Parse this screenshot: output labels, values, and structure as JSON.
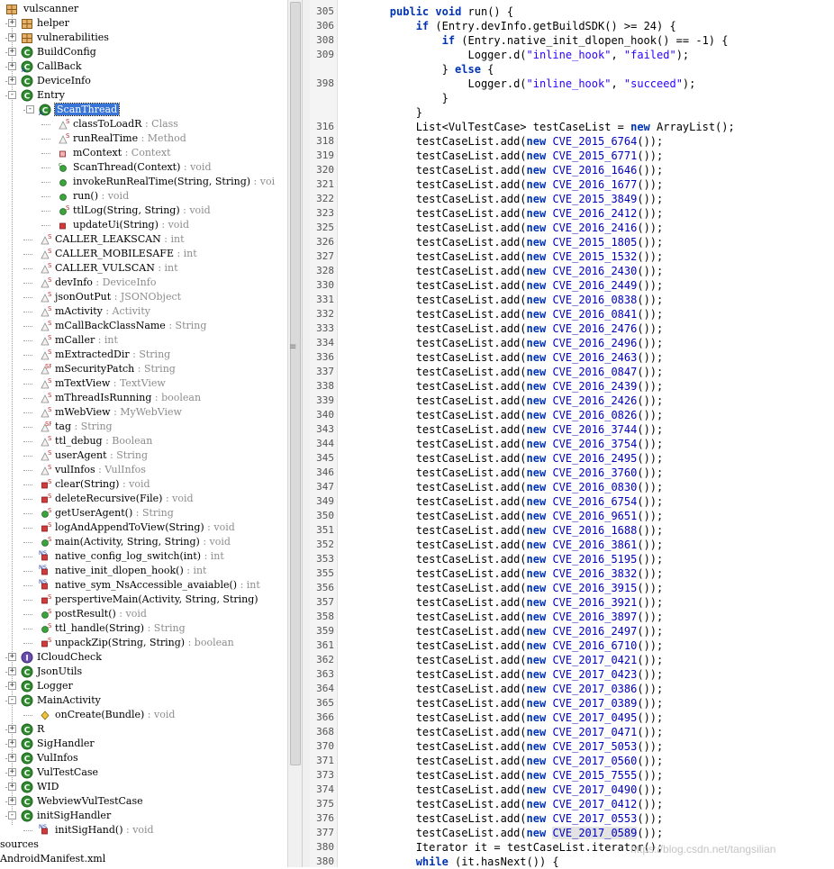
{
  "tree": {
    "root": "vulscanner",
    "items": [
      {
        "label": "helper",
        "icon": "package-icon",
        "depth": 1,
        "toggle": "+"
      },
      {
        "label": "vulnerabilities",
        "icon": "package-icon",
        "depth": 1,
        "toggle": "+"
      },
      {
        "label": "BuildConfig",
        "icon": "class-icon",
        "depth": 1,
        "toggle": "+"
      },
      {
        "label": "CallBack",
        "icon": "abstract-class-icon",
        "depth": 1,
        "toggle": "+"
      },
      {
        "label": "DeviceInfo",
        "icon": "class-icon",
        "depth": 1,
        "toggle": "+"
      },
      {
        "label": "Entry",
        "icon": "class-icon",
        "depth": 1,
        "toggle": "-"
      },
      {
        "label": "ScanThread",
        "icon": "inner-class-icon",
        "depth": 2,
        "toggle": "-",
        "selected": true
      },
      {
        "label": "classToLoadR",
        "type": "Class",
        "icon": "static-field-icon",
        "depth": 3
      },
      {
        "label": "runRealTime",
        "type": "Method",
        "icon": "static-field-icon",
        "depth": 3
      },
      {
        "label": "mContext",
        "type": "Context",
        "icon": "private-field-icon",
        "depth": 3
      },
      {
        "label": "ScanThread(Context)",
        "type": "void",
        "icon": "constructor-icon",
        "depth": 3
      },
      {
        "label": "invokeRunRealTime(String, String)",
        "type": "voi",
        "icon": "public-method-icon",
        "depth": 3
      },
      {
        "label": "run()",
        "type": "void",
        "icon": "public-method-icon",
        "depth": 3
      },
      {
        "label": "ttlLog(String, String)",
        "type": "void",
        "icon": "static-method-icon",
        "depth": 3
      },
      {
        "label": "updateUi(String)",
        "type": "void",
        "icon": "private-method-icon",
        "depth": 3
      },
      {
        "label": "CALLER_LEAKSCAN",
        "type": "int",
        "icon": "static-field-icon",
        "depth": 2
      },
      {
        "label": "CALLER_MOBILESAFE",
        "type": "int",
        "icon": "static-field-icon",
        "depth": 2
      },
      {
        "label": "CALLER_VULSCAN",
        "type": "int",
        "icon": "static-field-icon",
        "depth": 2
      },
      {
        "label": "devInfo",
        "type": "DeviceInfo",
        "icon": "static-field-icon",
        "depth": 2
      },
      {
        "label": "jsonOutPut",
        "type": "JSONObject",
        "icon": "static-field-icon",
        "depth": 2
      },
      {
        "label": "mActivity",
        "type": "Activity",
        "icon": "static-field-icon",
        "depth": 2
      },
      {
        "label": "mCallBackClassName",
        "type": "String",
        "icon": "static-field-icon",
        "depth": 2
      },
      {
        "label": "mCaller",
        "type": "int",
        "icon": "static-field-icon",
        "depth": 2
      },
      {
        "label": "mExtractedDir",
        "type": "String",
        "icon": "static-field-icon",
        "depth": 2
      },
      {
        "label": "mSecurityPatch",
        "type": "String",
        "icon": "static-final-field-icon",
        "depth": 2
      },
      {
        "label": "mTextView",
        "type": "TextView",
        "icon": "static-field-icon",
        "depth": 2
      },
      {
        "label": "mThreadIsRunning",
        "type": "boolean",
        "icon": "static-field-icon",
        "depth": 2
      },
      {
        "label": "mWebView",
        "type": "MyWebView",
        "icon": "static-field-icon",
        "depth": 2
      },
      {
        "label": "tag",
        "type": "String",
        "icon": "static-final-field-icon",
        "depth": 2
      },
      {
        "label": "ttl_debug",
        "type": "Boolean",
        "icon": "static-field-icon",
        "depth": 2
      },
      {
        "label": "userAgent",
        "type": "String",
        "icon": "static-field-icon",
        "depth": 2
      },
      {
        "label": "vulInfos",
        "type": "VulInfos",
        "icon": "static-field-icon",
        "depth": 2
      },
      {
        "label": "clear(String)",
        "type": "void",
        "icon": "private-static-method-icon",
        "depth": 2
      },
      {
        "label": "deleteRecursive(File)",
        "type": "void",
        "icon": "private-static-method-icon",
        "depth": 2
      },
      {
        "label": "getUserAgent()",
        "type": "String",
        "icon": "static-method-icon",
        "depth": 2
      },
      {
        "label": "logAndAppendToView(String)",
        "type": "void",
        "icon": "private-static-method-icon",
        "depth": 2
      },
      {
        "label": "main(Activity, String, String)",
        "type": "void",
        "icon": "static-method-icon",
        "depth": 2
      },
      {
        "label": "native_config_log_switch(int)",
        "type": "int",
        "icon": "native-method-icon",
        "depth": 2
      },
      {
        "label": "native_init_dlopen_hook()",
        "type": "int",
        "icon": "native-method-icon",
        "depth": 2
      },
      {
        "label": "native_sym_NsAccessible_avaiable()",
        "type": "int",
        "icon": "native-method-icon",
        "depth": 2
      },
      {
        "label": "perspertiveMain(Activity, String, String)",
        "type": "",
        "icon": "private-static-method-icon",
        "depth": 2
      },
      {
        "label": "postResult()",
        "type": "void",
        "icon": "static-method-icon",
        "depth": 2
      },
      {
        "label": "ttl_handle(String)",
        "type": "String",
        "icon": "static-method-icon",
        "depth": 2
      },
      {
        "label": "unpackZip(String, String)",
        "type": "boolean",
        "icon": "private-static-method-icon",
        "depth": 2
      },
      {
        "label": "ICloudCheck",
        "icon": "interface-icon",
        "depth": 1,
        "toggle": "+"
      },
      {
        "label": "JsonUtils",
        "icon": "class-icon",
        "depth": 1,
        "toggle": "+"
      },
      {
        "label": "Logger",
        "icon": "class-icon",
        "depth": 1,
        "toggle": "+"
      },
      {
        "label": "MainActivity",
        "icon": "class-icon",
        "depth": 1,
        "toggle": "-"
      },
      {
        "label": "onCreate(Bundle)",
        "type": "void",
        "icon": "protected-method-icon",
        "depth": 2
      },
      {
        "label": "R",
        "icon": "class-icon",
        "depth": 1,
        "toggle": "+"
      },
      {
        "label": "SigHandler",
        "icon": "class-icon",
        "depth": 1,
        "toggle": "+"
      },
      {
        "label": "VulInfos",
        "icon": "class-icon",
        "depth": 1,
        "toggle": "+"
      },
      {
        "label": "VulTestCase",
        "icon": "class-icon",
        "depth": 1,
        "toggle": "+"
      },
      {
        "label": "WID",
        "icon": "class-icon",
        "depth": 1,
        "toggle": "+"
      },
      {
        "label": "WebviewVulTestCase",
        "icon": "class-icon",
        "depth": 1,
        "toggle": "+"
      },
      {
        "label": "initSigHandler",
        "icon": "class-icon",
        "depth": 1,
        "toggle": "-"
      },
      {
        "label": "initSigHand()",
        "type": "void",
        "icon": "native-method-icon",
        "depth": 2
      },
      {
        "label": "sources",
        "icon": "",
        "depth": 0
      },
      {
        "label": "AndroidManifest.xml",
        "icon": "",
        "depth": 0
      }
    ]
  },
  "code": {
    "lines": [
      {
        "n": "305",
        "t": "        public void run() {"
      },
      {
        "n": "306",
        "t": "            if (Entry.devInfo.getBuildSDK() >= 24) {"
      },
      {
        "n": "308",
        "t": "                if (Entry.native_init_dlopen_hook() == -1) {"
      },
      {
        "n": "309",
        "t": "                    Logger.d(\"inline_hook\", \"failed\");"
      },
      {
        "n": "",
        "t": "                } else {"
      },
      {
        "n": "398",
        "t": "                    Logger.d(\"inline_hook\", \"succeed\");"
      },
      {
        "n": "",
        "t": "                }"
      },
      {
        "n": "",
        "t": "            }"
      },
      {
        "n": "316",
        "t": "            List<VulTestCase> testCaseList = new ArrayList();"
      },
      {
        "n": "318",
        "t": "            testCaseList.add(new CVE_2015_6764());"
      },
      {
        "n": "319",
        "t": "            testCaseList.add(new CVE_2015_6771());"
      },
      {
        "n": "320",
        "t": "            testCaseList.add(new CVE_2016_1646());"
      },
      {
        "n": "321",
        "t": "            testCaseList.add(new CVE_2016_1677());"
      },
      {
        "n": "322",
        "t": "            testCaseList.add(new CVE_2015_3849());"
      },
      {
        "n": "323",
        "t": "            testCaseList.add(new CVE_2016_2412());"
      },
      {
        "n": "325",
        "t": "            testCaseList.add(new CVE_2016_2416());"
      },
      {
        "n": "326",
        "t": "            testCaseList.add(new CVE_2015_1805());"
      },
      {
        "n": "327",
        "t": "            testCaseList.add(new CVE_2015_1532());"
      },
      {
        "n": "328",
        "t": "            testCaseList.add(new CVE_2016_2430());"
      },
      {
        "n": "330",
        "t": "            testCaseList.add(new CVE_2016_2449());"
      },
      {
        "n": "331",
        "t": "            testCaseList.add(new CVE_2016_0838());"
      },
      {
        "n": "332",
        "t": "            testCaseList.add(new CVE_2016_0841());"
      },
      {
        "n": "333",
        "t": "            testCaseList.add(new CVE_2016_2476());"
      },
      {
        "n": "334",
        "t": "            testCaseList.add(new CVE_2016_2496());"
      },
      {
        "n": "336",
        "t": "            testCaseList.add(new CVE_2016_2463());"
      },
      {
        "n": "337",
        "t": "            testCaseList.add(new CVE_2016_0847());"
      },
      {
        "n": "338",
        "t": "            testCaseList.add(new CVE_2016_2439());"
      },
      {
        "n": "339",
        "t": "            testCaseList.add(new CVE_2016_2426());"
      },
      {
        "n": "340",
        "t": "            testCaseList.add(new CVE_2016_0826());"
      },
      {
        "n": "343",
        "t": "            testCaseList.add(new CVE_2016_3744());"
      },
      {
        "n": "344",
        "t": "            testCaseList.add(new CVE_2016_3754());"
      },
      {
        "n": "345",
        "t": "            testCaseList.add(new CVE_2016_2495());"
      },
      {
        "n": "346",
        "t": "            testCaseList.add(new CVE_2016_3760());"
      },
      {
        "n": "347",
        "t": "            testCaseList.add(new CVE_2016_0830());"
      },
      {
        "n": "349",
        "t": "            testCaseList.add(new CVE_2016_6754());"
      },
      {
        "n": "350",
        "t": "            testCaseList.add(new CVE_2016_9651());"
      },
      {
        "n": "351",
        "t": "            testCaseList.add(new CVE_2016_1688());"
      },
      {
        "n": "352",
        "t": "            testCaseList.add(new CVE_2016_3861());"
      },
      {
        "n": "353",
        "t": "            testCaseList.add(new CVE_2016_5195());"
      },
      {
        "n": "355",
        "t": "            testCaseList.add(new CVE_2016_3832());"
      },
      {
        "n": "356",
        "t": "            testCaseList.add(new CVE_2016_3915());"
      },
      {
        "n": "357",
        "t": "            testCaseList.add(new CVE_2016_3921());"
      },
      {
        "n": "358",
        "t": "            testCaseList.add(new CVE_2016_3897());"
      },
      {
        "n": "359",
        "t": "            testCaseList.add(new CVE_2016_2497());"
      },
      {
        "n": "361",
        "t": "            testCaseList.add(new CVE_2016_6710());"
      },
      {
        "n": "362",
        "t": "            testCaseList.add(new CVE_2017_0421());"
      },
      {
        "n": "363",
        "t": "            testCaseList.add(new CVE_2017_0423());"
      },
      {
        "n": "364",
        "t": "            testCaseList.add(new CVE_2017_0386());"
      },
      {
        "n": "365",
        "t": "            testCaseList.add(new CVE_2017_0389());"
      },
      {
        "n": "366",
        "t": "            testCaseList.add(new CVE_2017_0495());"
      },
      {
        "n": "368",
        "t": "            testCaseList.add(new CVE_2017_0471());"
      },
      {
        "n": "370",
        "t": "            testCaseList.add(new CVE_2017_5053());"
      },
      {
        "n": "371",
        "t": "            testCaseList.add(new CVE_2017_0560());"
      },
      {
        "n": "373",
        "t": "            testCaseList.add(new CVE_2015_7555());"
      },
      {
        "n": "374",
        "t": "            testCaseList.add(new CVE_2017_0490());"
      },
      {
        "n": "375",
        "t": "            testCaseList.add(new CVE_2017_0412());"
      },
      {
        "n": "376",
        "t": "            testCaseList.add(new CVE_2017_0553());"
      },
      {
        "n": "377",
        "t": "            testCaseList.add(new CVE_2017_0589());",
        "hl": "CVE_2017_0589"
      },
      {
        "n": "380",
        "t": "            Iterator it = testCaseList.iterator();"
      },
      {
        "n": "380",
        "t": "            while (it.hasNext()) {"
      }
    ]
  },
  "watermark": "https://blog.csdn.net/tangsilian",
  "colors": {
    "selection": "#3875d7",
    "keyword": "#0033b3",
    "string": "#2a00ff",
    "class_icon": "#2e8b2e",
    "static_marker": "#cc2a2a"
  }
}
